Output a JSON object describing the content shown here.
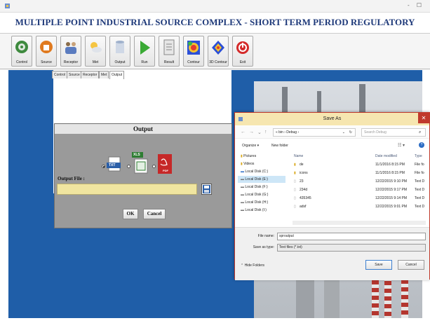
{
  "window": {
    "title_icon": "app-icon",
    "controls": "- ☐"
  },
  "app_title": "MULTIPLE POINT INDUSTRIAL SOURCE COMPLEX - SHORT TERM PERIOD REGULATORY MODEL (MPC_SPR)",
  "toolbar": [
    {
      "label": "Control",
      "icon": "gear-icon"
    },
    {
      "label": "Source",
      "icon": "factory-icon"
    },
    {
      "label": "Receptor",
      "icon": "people-icon"
    },
    {
      "label": "Met",
      "icon": "weather-icon"
    },
    {
      "label": "Output",
      "icon": "cylinder-icon"
    },
    {
      "label": "Run",
      "icon": "play-icon"
    },
    {
      "label": "Result",
      "icon": "document-icon"
    },
    {
      "label": "Contour",
      "icon": "contour-icon"
    },
    {
      "label": "3D Contour",
      "icon": "3d-contour-icon"
    },
    {
      "label": "Exit",
      "icon": "power-icon"
    }
  ],
  "tabs": [
    "Control",
    "Source",
    "Receptor",
    "Met",
    "Output"
  ],
  "output_panel": {
    "title": "Output",
    "formats": [
      "TXT",
      "XLS",
      "PDF"
    ],
    "selected_format": "TXT",
    "file_label": "Output File :",
    "file_value": "",
    "ok_label": "OK",
    "cancel_label": "Cancel"
  },
  "save_dialog": {
    "title": "Save As",
    "path": [
      "« bin",
      "Debug"
    ],
    "search_placeholder": "Search Debug",
    "organize": "Organize ▾",
    "new_folder": "New folder",
    "nav_items": [
      "Pictures",
      "Videos",
      "Local Disk (C:)",
      "Local Disk (E:)",
      "Local Disk (F:)",
      "Local Disk (G:)",
      "Local Disk (H:)",
      "Local Disk (I:)"
    ],
    "columns": {
      "name": "Name",
      "date": "Date modified",
      "type": "Type"
    },
    "files": [
      {
        "name": "de",
        "date": "11/1/2016 8:15 PM",
        "type": "File fo",
        "kind": "folder"
      },
      {
        "name": "icons",
        "date": "11/1/2016 8:15 PM",
        "type": "File fo",
        "kind": "folder"
      },
      {
        "name": "23",
        "date": "12/22/2015 9:10 PM",
        "type": "Text D",
        "kind": "file"
      },
      {
        "name": "234d",
        "date": "12/22/2015 9:17 PM",
        "type": "Text D",
        "kind": "file"
      },
      {
        "name": "435345",
        "date": "12/22/2015 9:14 PM",
        "type": "Text D",
        "kind": "file"
      },
      {
        "name": "adsf",
        "date": "12/22/2015 9:01 PM",
        "type": "Text D",
        "kind": "file"
      }
    ],
    "file_name_label": "File name:",
    "file_name_value": "sproutput",
    "save_type_label": "Save as type:",
    "save_type_value": "Text files (*.txt)",
    "hide_folders": "Hide Folders",
    "save_label": "Save",
    "cancel_label": "Cancel"
  },
  "colors": {
    "workspace": "#1f5ea8",
    "title_text": "#1f3a7a",
    "dialog_accent": "#c0392b",
    "output_field": "#f0e5a0"
  }
}
